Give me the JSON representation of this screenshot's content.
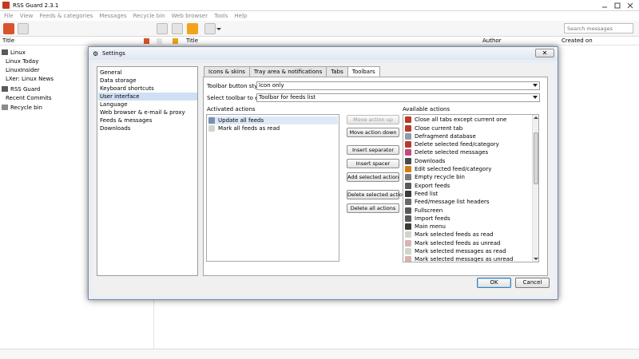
{
  "window": {
    "title": "RSS Guard 2.3.1"
  },
  "menu": [
    "File",
    "View",
    "Feeds & categories",
    "Messages",
    "Recycle bin",
    "Web browser",
    "Tools",
    "Help"
  ],
  "search": {
    "placeholder": "Search messages"
  },
  "feeds_header": {
    "title": "Title"
  },
  "messages_header": {
    "title": "Title",
    "author": "Author",
    "created_on": "Created on"
  },
  "feed_tree": [
    {
      "label": "Linux"
    },
    {
      "label": "Linux Today"
    },
    {
      "label": "LinuxInsider"
    },
    {
      "label": "LXer: Linux News"
    },
    {
      "label": "RSS Guard"
    },
    {
      "label": "Recent Commits"
    },
    {
      "label": "Recycle bin"
    }
  ],
  "dialog": {
    "title": "Settings",
    "close_label": "✕",
    "categories": [
      "General",
      "Data storage",
      "Keyboard shortcuts",
      "User interface",
      "Language",
      "Web browser & e-mail & proxy",
      "Feeds & messages",
      "Downloads"
    ],
    "selected_category": "User interface",
    "tabs": [
      "Icons & skins",
      "Tray area & notifications",
      "Tabs",
      "Toolbars"
    ],
    "active_tab": "Toolbars",
    "toolbar_button_style_label": "Toolbar button style",
    "toolbar_button_style_value": "Icon only",
    "select_toolbar_label": "Select toolbar to edit",
    "select_toolbar_value": "Toolbar for feeds list",
    "activated_actions_label": "Activated actions",
    "available_actions_label": "Available actions",
    "activated_actions": [
      "Update all feeds",
      "Mark all feeds as read"
    ],
    "buttons": {
      "move_up": "Move action up",
      "move_down": "Move action down",
      "insert_separator": "Insert separator",
      "insert_spacer": "Insert spacer",
      "add_selected": "Add selected action",
      "delete_selected": "Delete selected action",
      "delete_all": "Delete all actions"
    },
    "available_actions": [
      "Close all tabs except current one",
      "Close current tab",
      "Defragment database",
      "Delete selected feed/category",
      "Delete selected messages",
      "Downloads",
      "Edit selected feed/category",
      "Empty recycle bin",
      "Export feeds",
      "Feed list",
      "Feed/message list headers",
      "Fullscreen",
      "Import feeds",
      "Main menu",
      "Mark selected feeds as read",
      "Mark selected feeds as unread",
      "Mark selected messages as read",
      "Mark selected messages as unread"
    ],
    "ok_label": "OK",
    "cancel_label": "Cancel"
  }
}
